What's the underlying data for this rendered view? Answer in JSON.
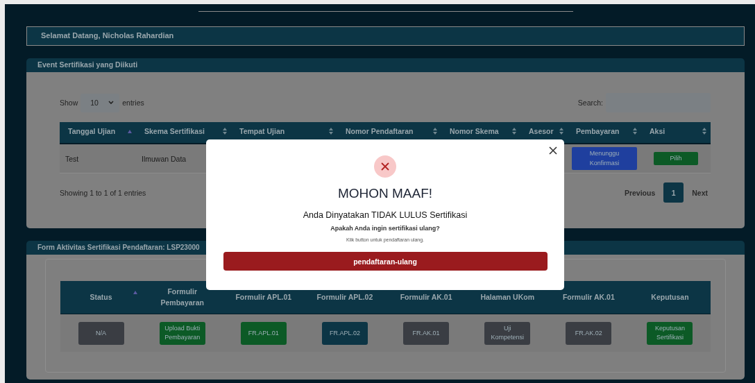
{
  "welcome": "Selamat Datang, Nicholas Rahardian",
  "events_panel": {
    "title": "Event Sertifikasi yang Diikuti",
    "length": {
      "show": "Show",
      "value": "10",
      "entries": "entries"
    },
    "search": {
      "label": "Search:"
    },
    "columns": [
      {
        "label": "Tanggal Ujian",
        "sorted": true
      },
      {
        "label": "Skema Sertifikasi",
        "sorted": false
      },
      {
        "label": "Tempat Ujian",
        "sorted": false
      },
      {
        "label": "Nomor Pendaftaran",
        "sorted": false
      },
      {
        "label": "Nomor Skema",
        "sorted": false
      },
      {
        "label": "Asesor",
        "sorted": false
      },
      {
        "label": "Pembayaran",
        "sorted": false
      },
      {
        "label": "Aksi",
        "sorted": false
      }
    ],
    "rows": [
      [
        {
          "kind": "text",
          "text": "Test"
        },
        {
          "kind": "text",
          "text": "Ilmuwan Data"
        },
        {
          "kind": "hidden"
        },
        {
          "kind": "hidden"
        },
        {
          "kind": "hidden"
        },
        {
          "kind": "hidden"
        },
        {
          "kind": "button",
          "text": "Menunggu Konfirmasi",
          "color": "#1f3f9e"
        },
        {
          "kind": "button",
          "text": "Pilih",
          "color": "#0c5a26"
        }
      ]
    ],
    "info": "Showing 1 to 1 of 1 entries",
    "pages": [
      {
        "label": "Previous",
        "kind": "nav",
        "selected": false
      },
      {
        "label": "1",
        "kind": "page",
        "selected": true
      },
      {
        "label": "Next",
        "kind": "nav",
        "selected": false
      }
    ]
  },
  "form_panel": {
    "title": "Form Aktivitas Sertifikasi Pendaftaran: LSP23000",
    "columns": [
      {
        "label": "Status",
        "sorted": true
      },
      {
        "label": "Formulir Pembayaran",
        "sorted": false
      },
      {
        "label": "Formulir APL.01",
        "sorted": false
      },
      {
        "label": "Formulir APL.02",
        "sorted": false
      },
      {
        "label": "Formulir AK.01",
        "sorted": false
      },
      {
        "label": "Halaman UKom",
        "sorted": false
      },
      {
        "label": "Formulir AK.01",
        "sorted": false
      },
      {
        "label": "Keputusan",
        "sorted": false
      }
    ],
    "row": [
      {
        "text": "N/A",
        "color": "#3a3d43"
      },
      {
        "text": "Upload Bukti Pembayaran",
        "color": "#0c5a26"
      },
      {
        "text": "FR.APL.01",
        "color": "#0c5a26"
      },
      {
        "text": "FR.APL.02",
        "color": "#0c3545"
      },
      {
        "text": "FR.AK.01",
        "color": "#3a3d43"
      },
      {
        "text": "Uji Kompetensi",
        "color": "#3a3d43"
      },
      {
        "text": "FR.AK.02",
        "color": "#3a3d43"
      },
      {
        "text": "Keputusan Sertifikasi",
        "color": "#0c5a26"
      }
    ]
  },
  "modal": {
    "title": "MOHON MAAF!",
    "message": "Anda Dinyatakan TIDAK LULUS Sertifikasi",
    "question": "Apakah Anda ingin sertifikasi ulang?",
    "hint": "Klik button untuk pendaftaran ulang.",
    "button": "pendaftaran-ulang"
  }
}
